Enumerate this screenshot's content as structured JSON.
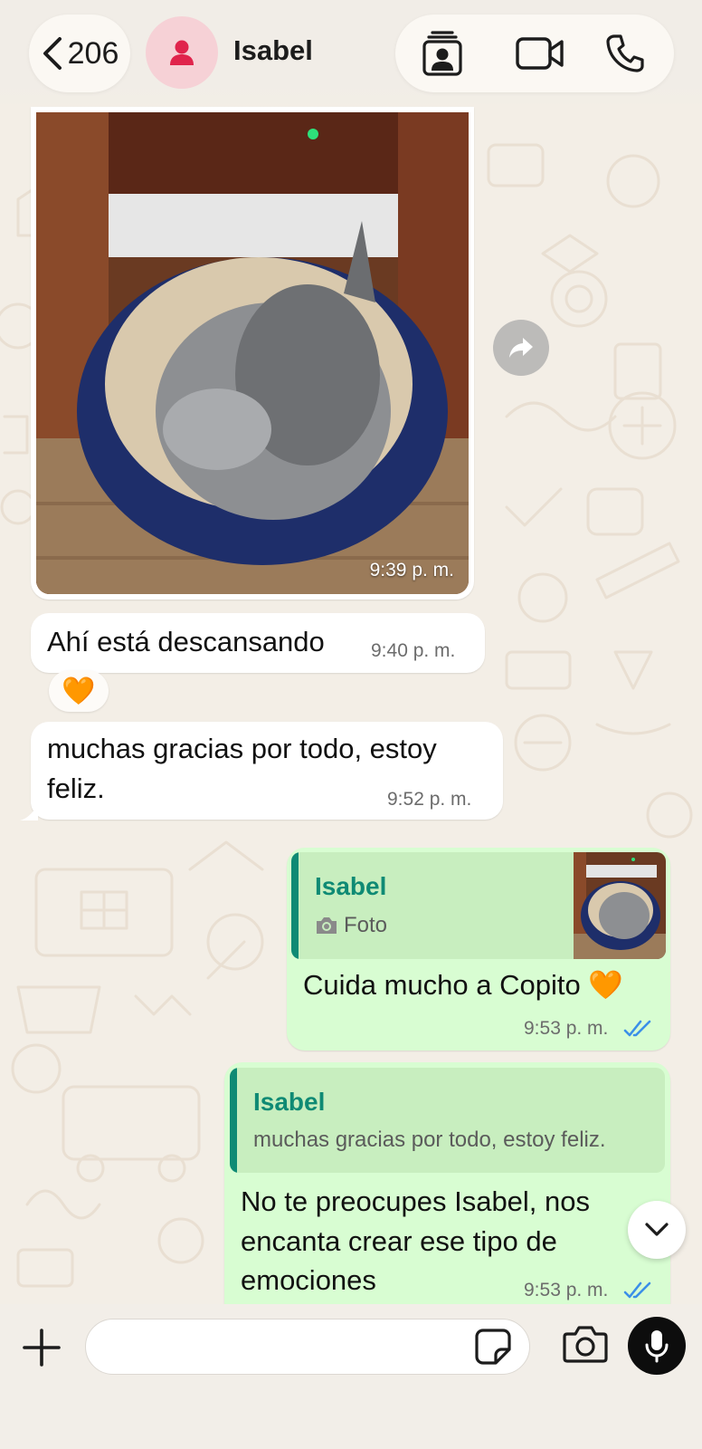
{
  "header": {
    "back_count": "206",
    "contact_name": "Isabel"
  },
  "messages": {
    "photo": {
      "time": "9:39 p. m."
    },
    "msg1": {
      "text": "Ahí está descansando",
      "time": "9:40 p. m.",
      "reaction": "🧡"
    },
    "msg2": {
      "line1": "muchas gracias por todo, estoy",
      "line2": "feliz.",
      "time": "9:52 p. m."
    },
    "msg3": {
      "quote_name": "Isabel",
      "quote_sub": "Foto",
      "text": "Cuida mucho a Copito 🧡",
      "time": "9:53 p. m.",
      "status": "read"
    },
    "msg4": {
      "quote_name": "Isabel",
      "quote_sub": "muchas gracias por todo, estoy feliz.",
      "line1": "No te preocupes Isabel, nos",
      "line2": "encanta crear ese tipo de",
      "line3": "emociones",
      "time": "9:53 p. m.",
      "status": "read"
    }
  },
  "composer": {
    "placeholder": ""
  },
  "icons": [
    "chevron-left-icon",
    "person-icon",
    "contact-card-icon",
    "video-camera-icon",
    "phone-icon",
    "forward-icon",
    "camera-icon",
    "chevron-down-icon",
    "plus-icon",
    "sticker-icon",
    "microphone-icon",
    "double-check-icon"
  ],
  "colors": {
    "chat_background": "#f3eee6",
    "incoming_bubble": "#ffffff",
    "outgoing_bubble": "#d8fdd2",
    "quote_accent": "#0f8a74",
    "read_ticks": "#3b8fe8",
    "avatar_bg": "#f6d1d6",
    "avatar_fg": "#e0244c"
  }
}
